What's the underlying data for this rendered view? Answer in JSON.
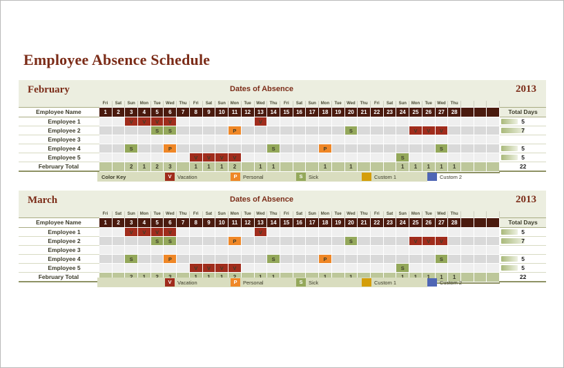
{
  "page": {
    "title": "Employee Absence Schedule"
  },
  "colors": {
    "vacation": "#a02c1c",
    "personal": "#ef8727",
    "sick": "#94a85b",
    "custom1": "#d49e09",
    "custom2": "#4f66b5",
    "header_dark": "#4a1a0e",
    "banner": "#eceee0",
    "total_row": "#bdc79a",
    "legend_bg": "#d9ddbf",
    "accent_text": "#7b2c18"
  },
  "legend": {
    "key_label": "Color Key",
    "items": [
      {
        "code": "V",
        "label": "Vacation",
        "color": "#a02c1c"
      },
      {
        "code": "P",
        "label": "Personal",
        "color": "#ef8727"
      },
      {
        "code": "S",
        "label": "Sick",
        "color": "#94a85b"
      },
      {
        "code": "",
        "label": "Custom 1",
        "color": "#d49e09"
      },
      {
        "code": "",
        "label": "Custom 2",
        "color": "#4f66b5"
      }
    ]
  },
  "sheets": [
    {
      "id": "feb",
      "month": "February",
      "year": "2013",
      "dates_header": "Dates of Absence",
      "name_header": "Employee Name",
      "total_header": "Total Days",
      "total_label": "February Total",
      "grand_total": "22",
      "daynames": [
        "Fri",
        "Sat",
        "Sun",
        "Mon",
        "Tue",
        "Wed",
        "Thu",
        "Fri",
        "Sat",
        "Sun",
        "Mon",
        "Tue",
        "Wed",
        "Thu",
        "Fri",
        "Sat",
        "Sun",
        "Mon",
        "Tue",
        "Wed",
        "Thu",
        "Fri",
        "Sat",
        "Sun",
        "Mon",
        "Tue",
        "Wed",
        "Thu",
        "",
        "",
        ""
      ],
      "daynums": [
        "1",
        "2",
        "3",
        "4",
        "5",
        "6",
        "7",
        "8",
        "9",
        "10",
        "11",
        "12",
        "13",
        "14",
        "15",
        "16",
        "17",
        "18",
        "19",
        "20",
        "21",
        "22",
        "23",
        "24",
        "25",
        "26",
        "27",
        "28",
        "",
        "",
        ""
      ],
      "rows": [
        {
          "name": "Employee 1",
          "total": "5",
          "bar": 36,
          "cells": [
            "",
            "",
            "V",
            "V",
            "V",
            "V",
            "",
            "",
            "",
            "",
            "",
            "",
            "V",
            "",
            "",
            "",
            "",
            "",
            "",
            "",
            "",
            "",
            "",
            "",
            "",
            "",
            "",
            "",
            "",
            "",
            ""
          ]
        },
        {
          "name": "Employee 2",
          "total": "7",
          "bar": 50,
          "cells": [
            "",
            "",
            "",
            "",
            "S",
            "S",
            "",
            "",
            "",
            "",
            "P",
            "",
            "",
            "",
            "",
            "",
            "",
            "",
            "",
            "S",
            "",
            "",
            "",
            "",
            "V",
            "V",
            "V",
            "",
            "",
            "",
            ""
          ]
        },
        {
          "name": "Employee 3",
          "total": "",
          "bar": 0,
          "cells": [
            "",
            "",
            "",
            "",
            "",
            "",
            "",
            "",
            "",
            "",
            "",
            "",
            "",
            "",
            "",
            "",
            "",
            "",
            "",
            "",
            "",
            "",
            "",
            "",
            "",
            "",
            "",
            "",
            "",
            "",
            ""
          ]
        },
        {
          "name": "Employee 4",
          "total": "5",
          "bar": 36,
          "cells": [
            "",
            "",
            "S",
            "",
            "",
            "P",
            "",
            "",
            "",
            "",
            "",
            "",
            "",
            "S",
            "",
            "",
            "",
            "P",
            "",
            "",
            "",
            "",
            "",
            "",
            "",
            "",
            "S",
            "",
            "",
            "",
            ""
          ]
        },
        {
          "name": "Employee 5",
          "total": "5",
          "bar": 36,
          "cells": [
            "",
            "",
            "",
            "",
            "",
            "",
            "",
            "V",
            "V",
            "V",
            "V",
            "",
            "",
            "",
            "",
            "",
            "",
            "",
            "",
            "",
            "",
            "",
            "",
            "S",
            "",
            "",
            "",
            "",
            "",
            "",
            ""
          ]
        }
      ],
      "totals": [
        "",
        "",
        "2",
        "1",
        "2",
        "3",
        "",
        "1",
        "1",
        "1",
        "2",
        "",
        "1",
        "1",
        "",
        "",
        "",
        "1",
        "",
        "1",
        "",
        "",
        "",
        "1",
        "1",
        "1",
        "1",
        "1",
        "",
        "",
        ""
      ]
    },
    {
      "id": "mar",
      "month": "March",
      "year": "2013",
      "dates_header": "Dates of Absence",
      "name_header": "Employee Name",
      "total_header": "Total Days",
      "total_label": "February Total",
      "grand_total": "22",
      "daynames": [
        "Fri",
        "Sat",
        "Sun",
        "Mon",
        "Tue",
        "Wed",
        "Thu",
        "Fri",
        "Sat",
        "Sun",
        "Mon",
        "Tue",
        "Wed",
        "Thu",
        "Fri",
        "Sat",
        "Sun",
        "Mon",
        "Tue",
        "Wed",
        "Thu",
        "Fri",
        "Sat",
        "Sun",
        "Mon",
        "Tue",
        "Wed",
        "Thu",
        "",
        "",
        ""
      ],
      "daynums": [
        "1",
        "2",
        "3",
        "4",
        "5",
        "6",
        "7",
        "8",
        "9",
        "10",
        "11",
        "12",
        "13",
        "14",
        "15",
        "16",
        "17",
        "18",
        "19",
        "20",
        "21",
        "22",
        "23",
        "24",
        "25",
        "26",
        "27",
        "28",
        "",
        "",
        ""
      ],
      "rows": [
        {
          "name": "Employee 1",
          "total": "5",
          "bar": 36,
          "cells": [
            "",
            "",
            "V",
            "V",
            "V",
            "V",
            "",
            "",
            "",
            "",
            "",
            "",
            "V",
            "",
            "",
            "",
            "",
            "",
            "",
            "",
            "",
            "",
            "",
            "",
            "",
            "",
            "",
            "",
            "",
            "",
            ""
          ]
        },
        {
          "name": "Employee 2",
          "total": "7",
          "bar": 50,
          "cells": [
            "",
            "",
            "",
            "",
            "S",
            "S",
            "",
            "",
            "",
            "",
            "P",
            "",
            "",
            "",
            "",
            "",
            "",
            "",
            "",
            "S",
            "",
            "",
            "",
            "",
            "V",
            "V",
            "V",
            "",
            "",
            "",
            ""
          ]
        },
        {
          "name": "Employee 3",
          "total": "",
          "bar": 0,
          "cells": [
            "",
            "",
            "",
            "",
            "",
            "",
            "",
            "",
            "",
            "",
            "",
            "",
            "",
            "",
            "",
            "",
            "",
            "",
            "",
            "",
            "",
            "",
            "",
            "",
            "",
            "",
            "",
            "",
            "",
            "",
            ""
          ]
        },
        {
          "name": "Employee 4",
          "total": "5",
          "bar": 36,
          "cells": [
            "",
            "",
            "S",
            "",
            "",
            "P",
            "",
            "",
            "",
            "",
            "",
            "",
            "",
            "S",
            "",
            "",
            "",
            "P",
            "",
            "",
            "",
            "",
            "",
            "",
            "",
            "",
            "S",
            "",
            "",
            "",
            ""
          ]
        },
        {
          "name": "Employee 5",
          "total": "5",
          "bar": 36,
          "cells": [
            "",
            "",
            "",
            "",
            "",
            "",
            "",
            "V",
            "V",
            "V",
            "V",
            "",
            "",
            "",
            "",
            "",
            "",
            "",
            "",
            "",
            "",
            "",
            "",
            "S",
            "",
            "",
            "",
            "",
            "",
            "",
            ""
          ]
        }
      ],
      "totals": [
        "",
        "",
        "2",
        "1",
        "2",
        "3",
        "",
        "1",
        "1",
        "1",
        "2",
        "",
        "1",
        "1",
        "",
        "",
        "",
        "1",
        "",
        "1",
        "",
        "",
        "",
        "1",
        "1",
        "1",
        "1",
        "1",
        "",
        "",
        ""
      ]
    }
  ]
}
